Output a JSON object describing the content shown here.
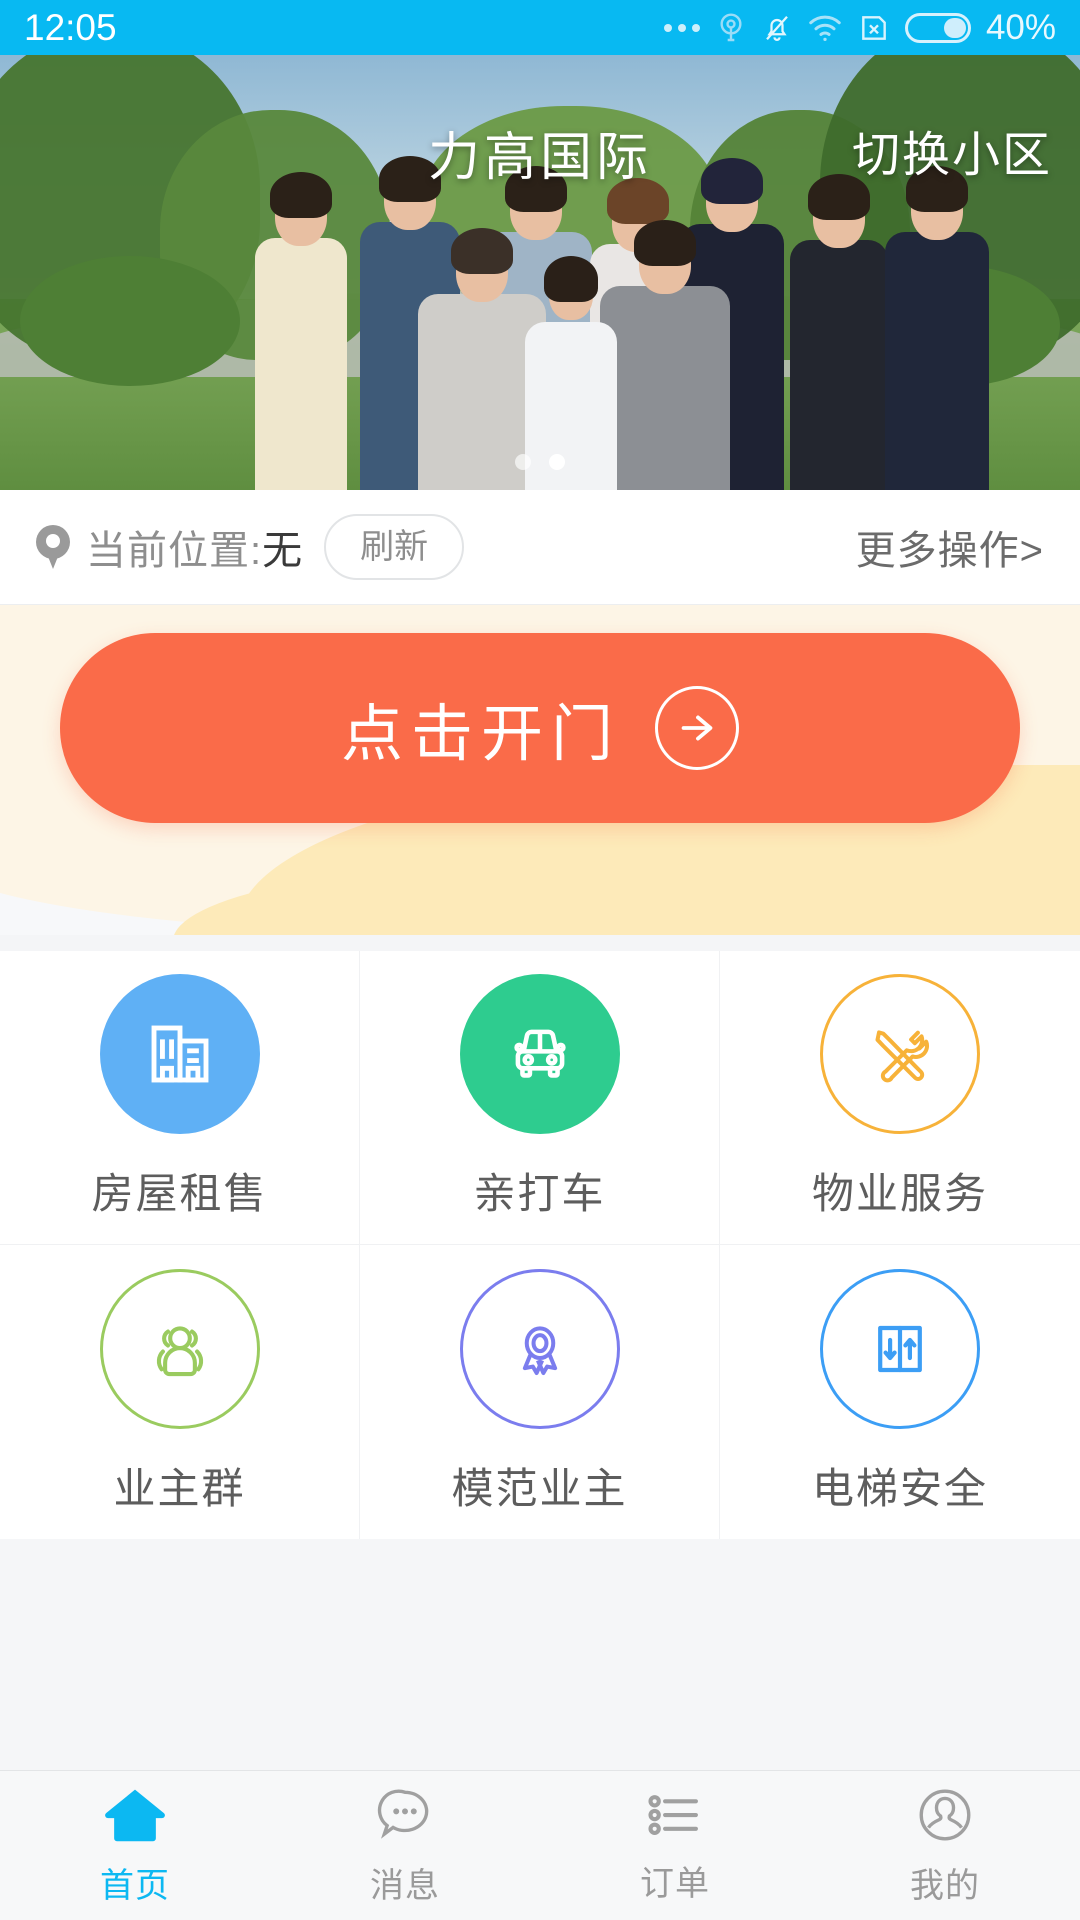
{
  "statusbar": {
    "time": "12:05",
    "battery_percent": "40%",
    "icons": [
      "more-dots-icon",
      "broadcast-icon",
      "mute-bell-icon",
      "wifi-icon",
      "no-sim-icon",
      "battery-icon"
    ]
  },
  "hero": {
    "community_name": "力高国际",
    "switch_label": "切换小区",
    "carousel": {
      "total": 2,
      "active": 1
    }
  },
  "location": {
    "pin_icon": "location-pin-icon",
    "label": "当前位置:",
    "value": "无",
    "refresh_label": "刷新",
    "more_label": "更多操作>"
  },
  "opendoor": {
    "label": "点击开门",
    "arrow_icon": "arrow-right-circle-icon",
    "color": "#FA6B49"
  },
  "grid": {
    "items": [
      {
        "label": "房屋租售",
        "icon": "building-icon",
        "style": "filled",
        "color": "#5FB0F5"
      },
      {
        "label": "亲打车",
        "icon": "car-icon",
        "style": "filled",
        "color": "#2ECC8F"
      },
      {
        "label": "物业服务",
        "icon": "tools-icon",
        "style": "outline",
        "color": "#F7B239"
      },
      {
        "label": "业主群",
        "icon": "group-icon",
        "style": "outline",
        "color": "#9ACB5F"
      },
      {
        "label": "模范业主",
        "icon": "medal-icon",
        "style": "outline",
        "color": "#7B7DEE"
      },
      {
        "label": "电梯安全",
        "icon": "elevator-icon",
        "style": "outline",
        "color": "#3C9EF5"
      }
    ]
  },
  "tabbar": {
    "active_color": "#0CB8F2",
    "items": [
      {
        "label": "首页",
        "icon": "home-icon",
        "active": true
      },
      {
        "label": "消息",
        "icon": "chat-icon",
        "active": false
      },
      {
        "label": "订单",
        "icon": "list-icon",
        "active": false
      },
      {
        "label": "我的",
        "icon": "user-icon",
        "active": false
      }
    ]
  }
}
